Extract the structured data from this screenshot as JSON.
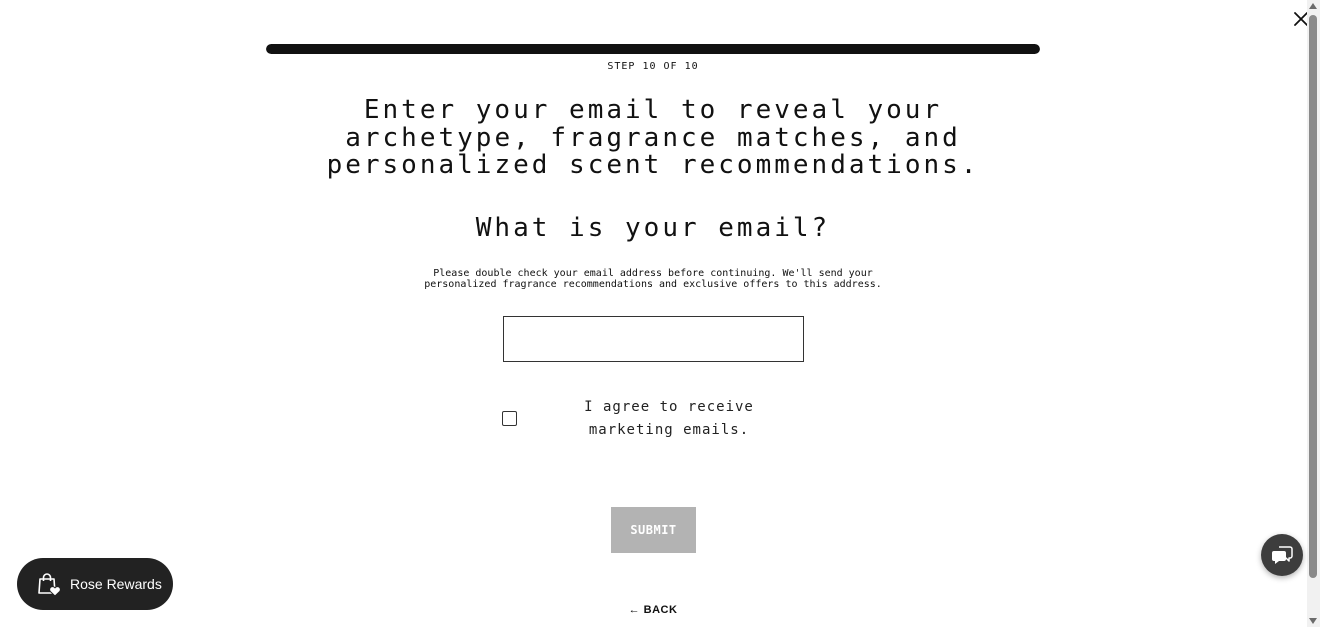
{
  "modal": {
    "close_icon": "close-icon",
    "progress": {
      "current": 10,
      "total": 10,
      "fraction": 1.0,
      "color": "#111111"
    },
    "step_label": "STEP 10 OF 10",
    "headline": "Enter your email to reveal your archetype, fragrance matches, and personalized scent recommendations.",
    "question": "What is your email?",
    "note": "Please double check your email address before continuing. We'll send your personalized fragrance recommendations and exclusive offers to this address.",
    "email_input": {
      "value": "",
      "placeholder": ""
    },
    "consent": {
      "checked": false,
      "label": "I agree to receive marketing emails."
    },
    "submit_label": "SUBMIT",
    "submit_color": "#b3b3b3",
    "back_label": "← BACK"
  },
  "rewards_widget": {
    "label": "Rose Rewards",
    "icon": "shopping-bag-heart-icon",
    "color": "#222222"
  },
  "chat_widget": {
    "icon": "chat-bubbles-icon",
    "color": "#3d3d3d"
  },
  "scrollbar": {
    "up_icon": "scroll-up-arrow-icon",
    "down_icon": "scroll-down-arrow-icon"
  }
}
